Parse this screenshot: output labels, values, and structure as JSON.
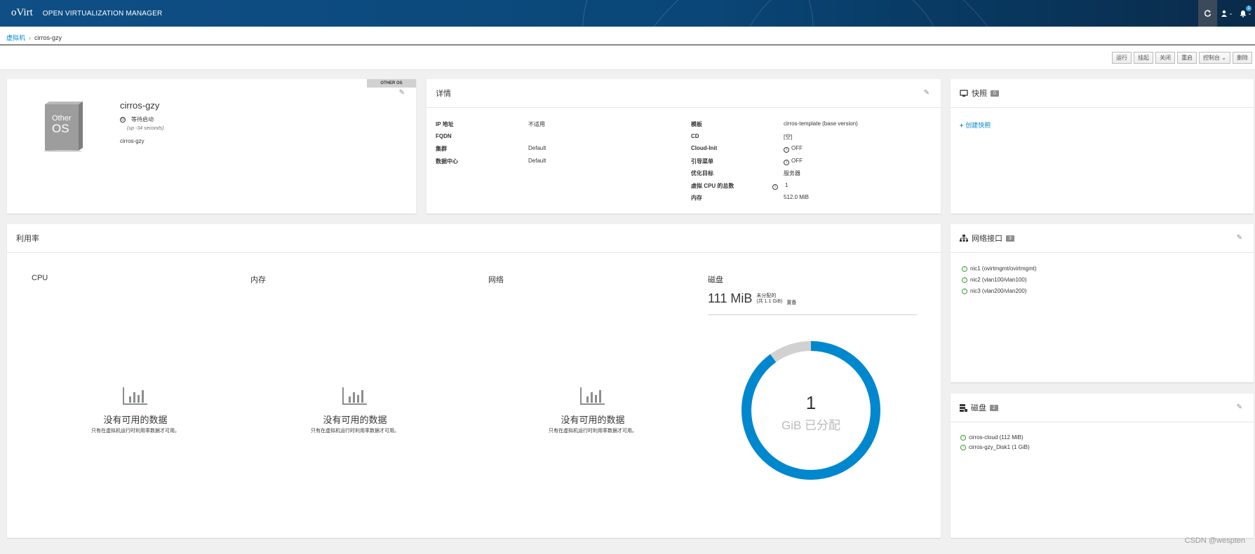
{
  "navbar": {
    "logo": "oVirt",
    "title": "OPEN VIRTUALIZATION MANAGER",
    "refresh_icon": "refresh-icon",
    "user_icon": "user-icon",
    "bell_icon": "bell-icon",
    "notification_count": "1"
  },
  "breadcrumb": {
    "parent": "虚拟机",
    "current": "cirros-gzy"
  },
  "toolbar": {
    "run": "运行",
    "suspend": "挂起",
    "shutdown": "关闭",
    "reboot": "重启",
    "console": "控制台 ⌄",
    "remove": "删除"
  },
  "vm": {
    "os_tag": "OTHER OS",
    "os_box_line1": "Other",
    "os_box_line2": "OS",
    "name": "cirros-gzy",
    "status": "等待启动",
    "uptime": "(up -34 seconds)",
    "host": "cirros-gzy"
  },
  "details": {
    "title": "详情",
    "left": [
      {
        "k": "IP 地址",
        "v": "不适用"
      },
      {
        "k": "FQDN",
        "v": ""
      },
      {
        "k": "集群",
        "v": "Default"
      },
      {
        "k": "数据中心",
        "v": "Default"
      }
    ],
    "right": [
      {
        "k": "模板",
        "v": "cirros-template (base version)"
      },
      {
        "k": "CD",
        "v": "[空]"
      },
      {
        "k": "Cloud-Init",
        "v": "OFF"
      },
      {
        "k": "引导菜单",
        "v": "OFF"
      },
      {
        "k": "优化目标",
        "v": "服务器"
      },
      {
        "k": "虚拟 CPU 的总数",
        "v": "1"
      },
      {
        "k": "内存",
        "v": "512.0 MiB"
      }
    ]
  },
  "snapshots": {
    "title": "快照",
    "count": "0",
    "create": "创建快照"
  },
  "utilization": {
    "title": "利用率",
    "cpu": "CPU",
    "memory": "内存",
    "network": "网络",
    "disk": "磁盘",
    "no_data": "没有可用的数据",
    "no_data_sub": "只有在虚拟机运行时利用率数据才可用。",
    "disk_amount": "111 MiB",
    "disk_unalloc": "未分配的",
    "disk_total": "(共 1.1 GiB)",
    "disk_over": "置备",
    "donut_value": "1",
    "donut_unit": "GiB 已分配",
    "donut_used_fraction": 0.9
  },
  "nics": {
    "title": "网络接口",
    "count": "3",
    "items": [
      "nic1 (ovirtmgmt/ovirtmgmt)",
      "nic2 (vlan100/vlan100)",
      "nic3 (vlan200/vlan200)"
    ]
  },
  "disks": {
    "title": "磁盘",
    "count": "2",
    "items": [
      "cirros-cloud (112 MiB)",
      "cirros-gzy_Disk1 (1 GiB)"
    ]
  },
  "watermark": "CSDN @wespten",
  "colors": {
    "accent": "#0088ce",
    "up": "#3f9c35",
    "donut_free": "#d1d1d1"
  }
}
